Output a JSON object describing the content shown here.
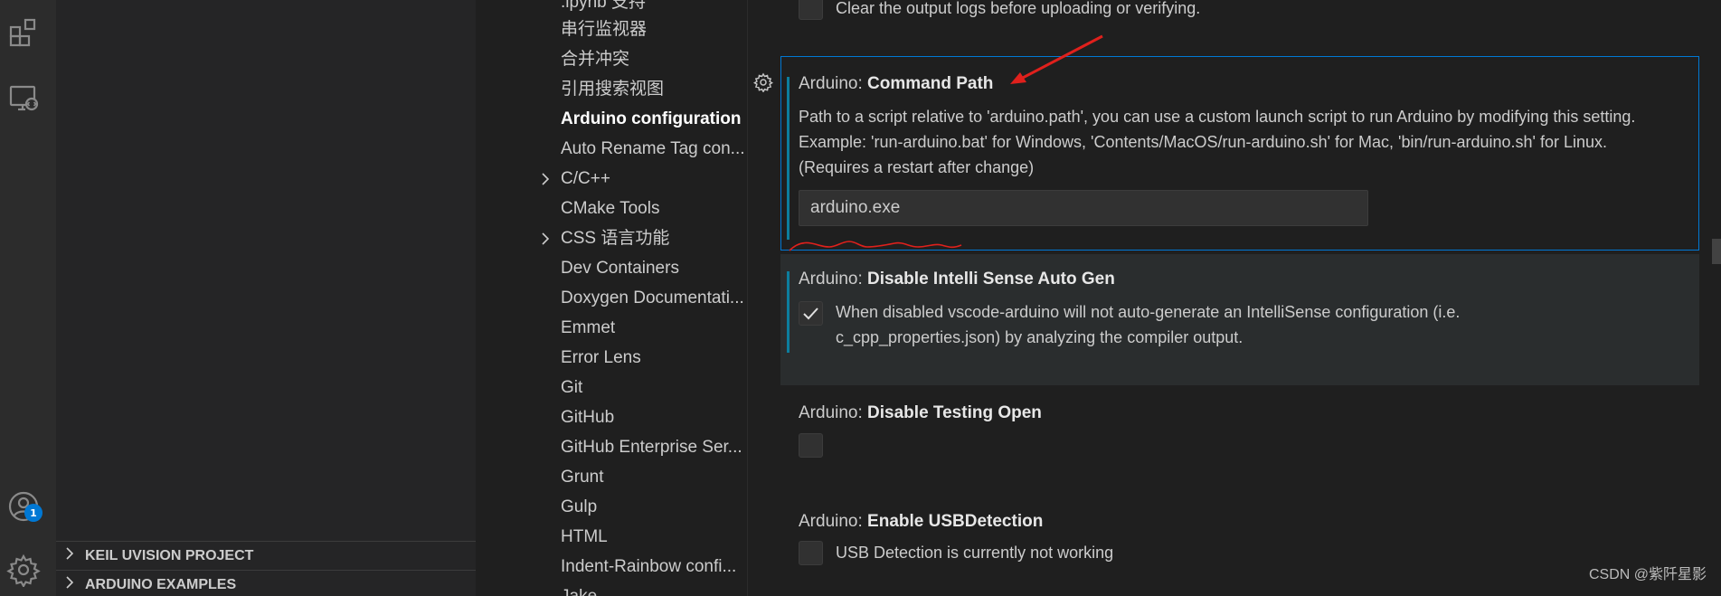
{
  "activity_bar": {
    "icons": [
      "extensions-icon",
      "remote-explorer-icon",
      "accounts-icon",
      "manage-gear-icon"
    ],
    "accounts_badge": "1"
  },
  "side_panels": {
    "keil": "KEIL UVISION PROJECT",
    "arduino_examples": "ARDUINO EXAMPLES"
  },
  "toc": {
    "items": [
      ".ipynb 支持",
      "串行监视器",
      "合并冲突",
      "引用搜索视图",
      "Arduino configuration",
      "Auto Rename Tag con...",
      "C/C++",
      "CMake Tools",
      "CSS 语言功能",
      "Dev Containers",
      "Doxygen Documentati...",
      "Emmet",
      "Error Lens",
      "Git",
      "GitHub",
      "GitHub Enterprise Ser...",
      "Grunt",
      "Gulp",
      "HTML",
      "Indent-Rainbow confi...",
      "Jake"
    ],
    "active_index": 4
  },
  "settings": {
    "clear_output": {
      "description": "Clear the output logs before uploading or verifying.",
      "checked": false
    },
    "command_path": {
      "prefix": "Arduino: ",
      "name": "Command Path",
      "description": "Path to a script relative to 'arduino.path', you can use a custom launch script to run Arduino by modifying this setting. Example: 'run-arduino.bat' for Windows, 'Contents/MacOS/run-arduino.sh' for Mac, 'bin/run-arduino.sh' for Linux. (Requires a restart after change)",
      "value": "arduino.exe"
    },
    "disable_intellisense": {
      "prefix": "Arduino: ",
      "name": "Disable Intelli Sense Auto Gen",
      "description": "When disabled vscode-arduino will not auto-generate an IntelliSense configuration (i.e. c_cpp_properties.json) by analyzing the compiler output.",
      "checked": true
    },
    "disable_testing": {
      "prefix": "Arduino: ",
      "name": "Disable Testing Open",
      "checked": false
    },
    "usb_detection": {
      "prefix": "Arduino: ",
      "name": "Enable USBDetection",
      "description": "USB Detection is currently not working",
      "checked": false
    }
  },
  "watermark": "CSDN @紫阡星影",
  "colors": {
    "accent": "#0078d4",
    "modified_indicator": "#0c7d9d",
    "annotation_red": "#e0201c"
  }
}
